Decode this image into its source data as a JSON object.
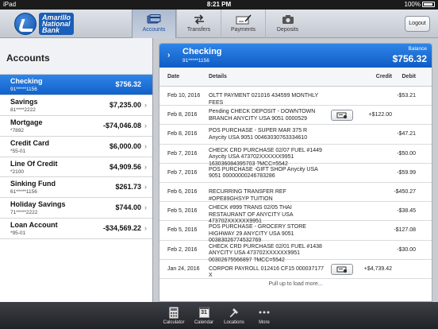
{
  "status": {
    "carrier": "iPad",
    "time": "8:21 PM",
    "battery": "100%"
  },
  "bank": {
    "name_line1": "Amarillo",
    "name_line2": "National",
    "name_line3": "Bank"
  },
  "nav": [
    {
      "label": "Accounts",
      "icon": "wallet-icon",
      "active": true
    },
    {
      "label": "Transfers",
      "icon": "transfer-arrows-icon",
      "active": false
    },
    {
      "label": "Payments",
      "icon": "check-pen-icon",
      "active": false
    },
    {
      "label": "Deposits",
      "icon": "camera-icon",
      "active": false
    }
  ],
  "logout_label": "Logout",
  "accounts_title": "Accounts",
  "accounts": [
    {
      "name": "Checking",
      "number": "91*****1156",
      "balance": "$756.32",
      "selected": true
    },
    {
      "name": "Savings",
      "number": "81****2222",
      "balance": "$7,235.00"
    },
    {
      "name": "Mortgage",
      "number": "*7892",
      "balance": "-$74,046.08"
    },
    {
      "name": "Credit Card",
      "number": "*55-01",
      "balance": "$6,000.00"
    },
    {
      "name": "Line Of Credit",
      "number": "*2100",
      "balance": "$4,909.56"
    },
    {
      "name": "Sinking Fund",
      "number": "61*****1156",
      "balance": "$261.73"
    },
    {
      "name": "Holiday Savings",
      "number": "71*****2222",
      "balance": "$744.00"
    },
    {
      "name": "Loan Account",
      "number": "*95-01",
      "balance": "-$34,569.22"
    }
  ],
  "detail": {
    "account_name": "Checking",
    "account_number": "91*****1156",
    "balance_label": "Balance",
    "balance": "$756.32",
    "columns": {
      "date": "Date",
      "details": "Details",
      "credit": "Credit",
      "debit": "Debit"
    },
    "transactions": [
      {
        "date": "Feb 10, 2016",
        "details": "OLTT PAYMENT 021016 434599 MONTHLY FEES",
        "credit": "",
        "debit": "-$53.21",
        "has_check_image": false
      },
      {
        "date": "Feb 8, 2016",
        "details": "Pending CHECK DEPOSIT - DOWNTOWN BRANCH ANYCITY USA 9051 0000529",
        "credit": "+$122.00",
        "debit": "",
        "has_check_image": true
      },
      {
        "date": "Feb 8, 2016",
        "details": "POS PURCHASE -  SUPER MAR 375 R Anycity USA 9051 00463030763334610",
        "credit": "",
        "debit": "-$47.21",
        "has_check_image": false
      },
      {
        "date": "Feb 7, 2016",
        "details": "CHECK CRD PURCHASE 02/07  FUEL #1449 Anycity USA 473702XXXXXX9951 163036084395703 ?MCC=5542",
        "credit": "",
        "debit": "-$50.00",
        "has_check_image": false
      },
      {
        "date": "Feb 7, 2016",
        "details": "POS PURCHASE -GIFT SHOP Anycity USA 9051 00000000246783286",
        "credit": "",
        "debit": "-$59.99",
        "has_check_image": false
      },
      {
        "date": "Feb 6, 2016",
        "details": "RECURRING TRANSFER REF #OPE89GHSYP TUITION",
        "credit": "",
        "debit": "-$450.27",
        "has_check_image": false
      },
      {
        "date": "Feb 5, 2016",
        "details": "CHECK #999 TRANS 02/05 THAI RESTAURANT OF ANYCITY USA 473702XXXXXX9951",
        "credit": "",
        "debit": "-$38.45",
        "has_check_image": false
      },
      {
        "date": "Feb 5, 2016",
        "details": "POS PURCHASE - GROCERY STORE HIGHWAY 29 ANYCITY USA 9051 00383026774532769",
        "credit": "",
        "debit": "-$127.08",
        "has_check_image": false
      },
      {
        "date": "Feb 2, 2016",
        "details": "CHECK CRD PURCHASE 02/01  FUEL #1438 ANYCITY USA 473702XXXXXX9951 00302675566897 ?MCC=5542",
        "credit": "",
        "debit": "-$30.00",
        "has_check_image": false
      },
      {
        "date": "Jan 24, 2016",
        "details": "CORPOR PAYROLL 012416 CF15 000037177 X",
        "credit": "+$4,739.42",
        "debit": "",
        "has_check_image": true
      }
    ],
    "pull_hint": "Pull up to load more..."
  },
  "toolbar": [
    {
      "label": "Calculator",
      "icon": "calculator-icon"
    },
    {
      "label": "Calendar",
      "icon": "calendar-icon",
      "day": "31"
    },
    {
      "label": "Locations",
      "icon": "pin-icon"
    },
    {
      "label": "More",
      "icon": "more-dots-icon"
    }
  ],
  "colors": {
    "accent": "#1a6fd6",
    "header": "#c9ced6",
    "toolbar": "#2a2c30"
  }
}
